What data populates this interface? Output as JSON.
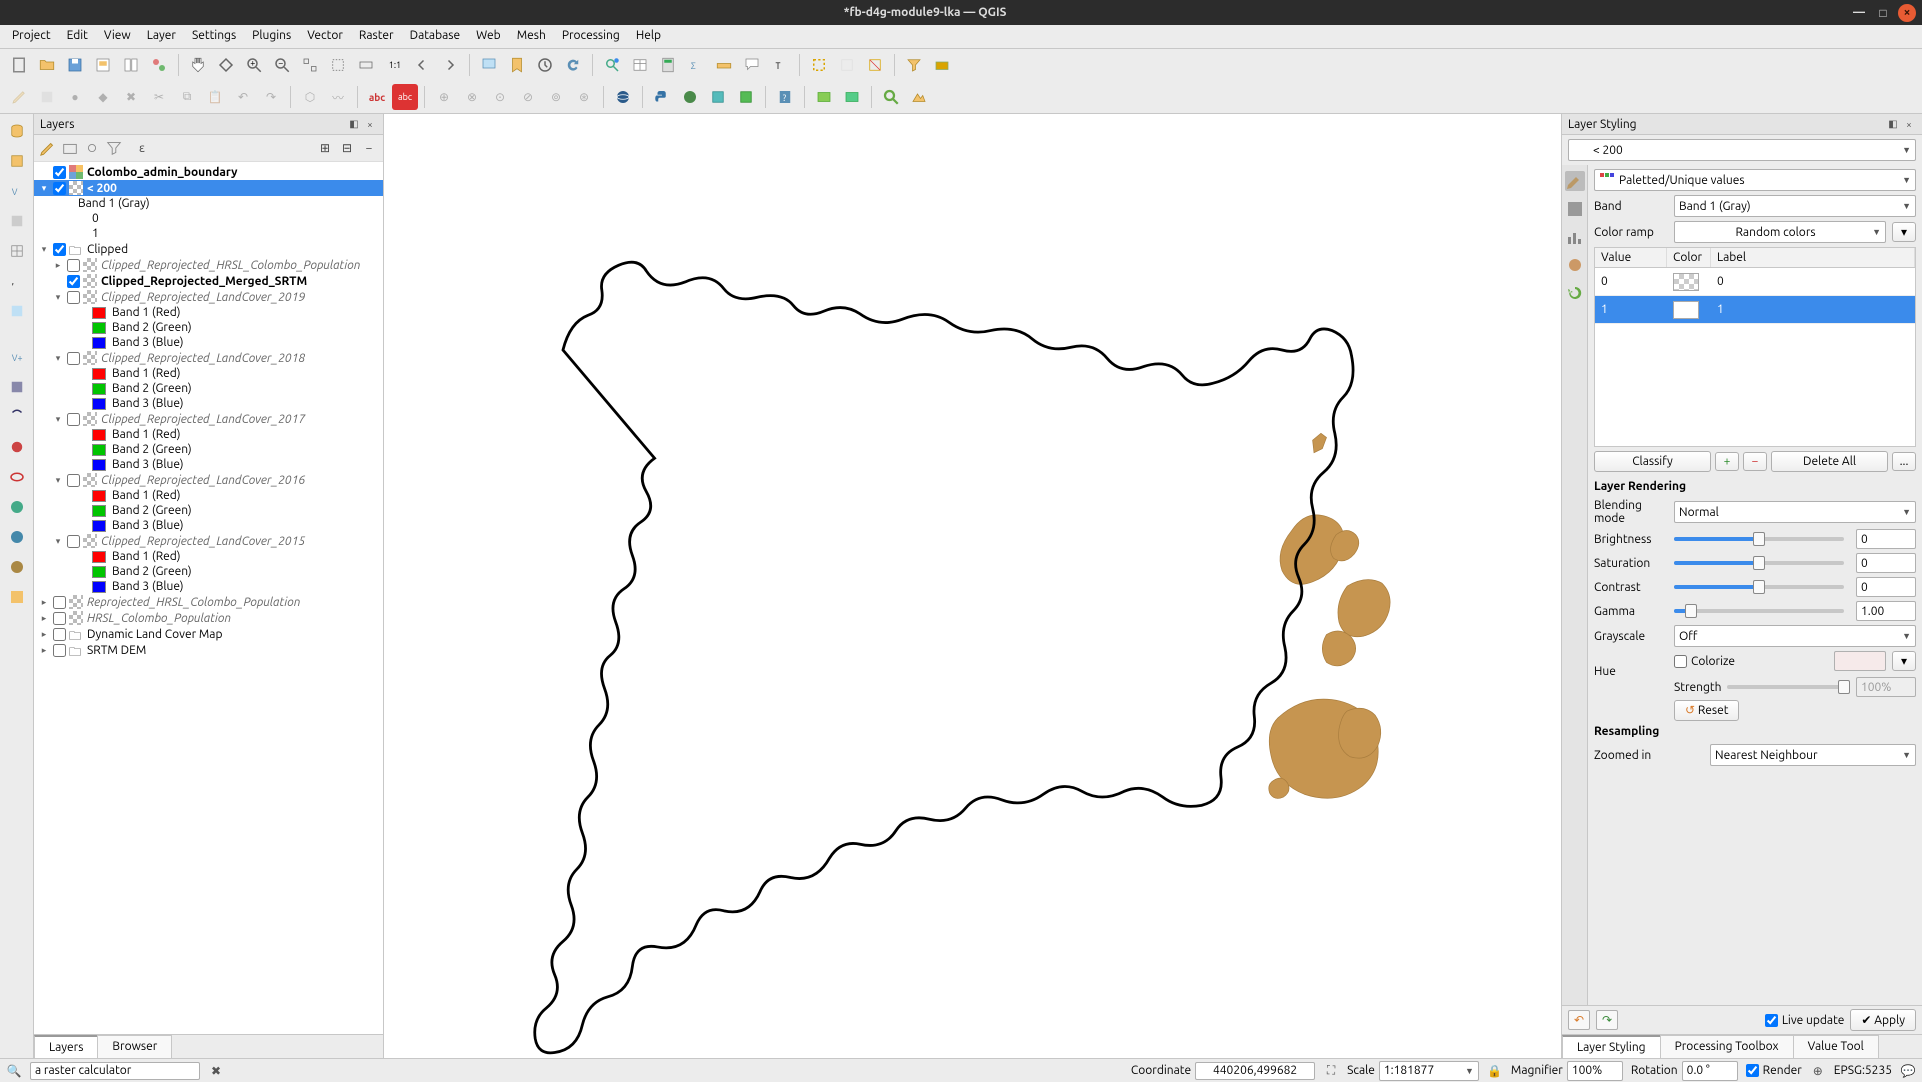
{
  "title": "*fb-d4g-module9-lka — QGIS",
  "menubar": [
    "Project",
    "Edit",
    "View",
    "Layer",
    "Settings",
    "Plugins",
    "Vector",
    "Raster",
    "Database",
    "Web",
    "Mesh",
    "Processing",
    "Help"
  ],
  "layers_panel": {
    "title": "Layers",
    "tabs": {
      "layers": "Layers",
      "browser": "Browser"
    }
  },
  "layers_tree": [
    {
      "depth": 1,
      "expander": "",
      "checked": true,
      "iconType": "vector",
      "label": "Colombo_admin_boundary",
      "bold": true
    },
    {
      "depth": 1,
      "expander": "▾",
      "checked": true,
      "iconType": "raster",
      "label": "< 200",
      "bold": true,
      "selected": true
    },
    {
      "depth": 3,
      "label": "Band 1 (Gray)"
    },
    {
      "depth": 4,
      "label": "0"
    },
    {
      "depth": 4,
      "label": "1"
    },
    {
      "depth": 1,
      "expander": "▾",
      "checked": true,
      "iconType": "group",
      "label": "Clipped"
    },
    {
      "depth": 2,
      "expander": "▸",
      "checked": false,
      "iconType": "raster",
      "label": "Clipped_Reprojected_HRSL_Colombo_Population",
      "ital": true
    },
    {
      "depth": 2,
      "expander": "",
      "checked": true,
      "iconType": "raster",
      "label": "Clipped_Reprojected_Merged_SRTM",
      "bold": true
    },
    {
      "depth": 2,
      "expander": "▾",
      "checked": false,
      "iconType": "raster",
      "label": "Clipped_Reprojected_LandCover_2019",
      "ital": true
    },
    {
      "depth": 4,
      "swatch": "#ff0000",
      "label": "Band 1 (Red)"
    },
    {
      "depth": 4,
      "swatch": "#00c400",
      "label": "Band 2 (Green)"
    },
    {
      "depth": 4,
      "swatch": "#0000ff",
      "label": "Band 3 (Blue)"
    },
    {
      "depth": 2,
      "expander": "▾",
      "checked": false,
      "iconType": "raster",
      "label": "Clipped_Reprojected_LandCover_2018",
      "ital": true
    },
    {
      "depth": 4,
      "swatch": "#ff0000",
      "label": "Band 1 (Red)"
    },
    {
      "depth": 4,
      "swatch": "#00c400",
      "label": "Band 2 (Green)"
    },
    {
      "depth": 4,
      "swatch": "#0000ff",
      "label": "Band 3 (Blue)"
    },
    {
      "depth": 2,
      "expander": "▾",
      "checked": false,
      "iconType": "raster",
      "label": "Clipped_Reprojected_LandCover_2017",
      "ital": true
    },
    {
      "depth": 4,
      "swatch": "#ff0000",
      "label": "Band 1 (Red)"
    },
    {
      "depth": 4,
      "swatch": "#00c400",
      "label": "Band 2 (Green)"
    },
    {
      "depth": 4,
      "swatch": "#0000ff",
      "label": "Band 3 (Blue)"
    },
    {
      "depth": 2,
      "expander": "▾",
      "checked": false,
      "iconType": "raster",
      "label": "Clipped_Reprojected_LandCover_2016",
      "ital": true
    },
    {
      "depth": 4,
      "swatch": "#ff0000",
      "label": "Band 1 (Red)"
    },
    {
      "depth": 4,
      "swatch": "#00c400",
      "label": "Band 2 (Green)"
    },
    {
      "depth": 4,
      "swatch": "#0000ff",
      "label": "Band 3 (Blue)"
    },
    {
      "depth": 2,
      "expander": "▾",
      "checked": false,
      "iconType": "raster",
      "label": "Clipped_Reprojected_LandCover_2015",
      "ital": true
    },
    {
      "depth": 4,
      "swatch": "#ff0000",
      "label": "Band 1 (Red)"
    },
    {
      "depth": 4,
      "swatch": "#00c400",
      "label": "Band 2 (Green)"
    },
    {
      "depth": 4,
      "swatch": "#0000ff",
      "label": "Band 3 (Blue)"
    },
    {
      "depth": 1,
      "expander": "▸",
      "checked": false,
      "iconType": "raster",
      "label": "Reprojected_HRSL_Colombo_Population",
      "ital": true
    },
    {
      "depth": 1,
      "expander": "▸",
      "checked": false,
      "iconType": "raster",
      "label": "HRSL_Colombo_Population",
      "ital": true
    },
    {
      "depth": 1,
      "expander": "▸",
      "checked": false,
      "iconType": "group",
      "label": "Dynamic Land Cover Map"
    },
    {
      "depth": 1,
      "expander": "▸",
      "checked": false,
      "iconType": "group",
      "label": "SRTM DEM"
    }
  ],
  "styling": {
    "title": "Layer Styling",
    "layer": "< 200",
    "renderer": "Paletted/Unique values",
    "band_label": "Band",
    "band": "Band 1 (Gray)",
    "ramp_label": "Color ramp",
    "ramp": "Random colors",
    "columns": {
      "value": "Value",
      "color": "Color",
      "label": "Label"
    },
    "rows": [
      {
        "value": "0",
        "color": "checker",
        "label": "0"
      },
      {
        "value": "1",
        "color": "#ffffff",
        "label": "1",
        "selected": true
      }
    ],
    "classify": "Classify",
    "add": "+",
    "remove": "−",
    "delete_all": "Delete All",
    "more": "...",
    "rendering_title": "Layer Rendering",
    "blend_label": "Blending mode",
    "blend": "Normal",
    "brightness_label": "Brightness",
    "brightness": "0",
    "saturation_label": "Saturation",
    "saturation": "0",
    "contrast_label": "Contrast",
    "contrast": "0",
    "gamma_label": "Gamma",
    "gamma": "1.00",
    "grayscale_label": "Grayscale",
    "grayscale": "Off",
    "hue_label": "Hue",
    "colorize": "Colorize",
    "strength_label": "Strength",
    "strength": "100%",
    "reset": "Reset",
    "resampling_title": "Resampling",
    "zoomed_in_label": "Zoomed in",
    "zoomed_in": "Nearest Neighbour",
    "live_update": "Live update",
    "apply": "Apply",
    "tabs": {
      "styling": "Layer Styling",
      "toolbox": "Processing Toolbox",
      "value": "Value Tool"
    }
  },
  "statusbar": {
    "search": "a raster calculator",
    "coord_label": "Coordinate",
    "coord": "440206,499682",
    "scale_label": "Scale",
    "scale": "1:181877",
    "magnifier_label": "Magnifier",
    "magnifier": "100%",
    "rotation_label": "Rotation",
    "rotation": "0.0 °",
    "render": "Render",
    "crs": "EPSG:5235"
  }
}
